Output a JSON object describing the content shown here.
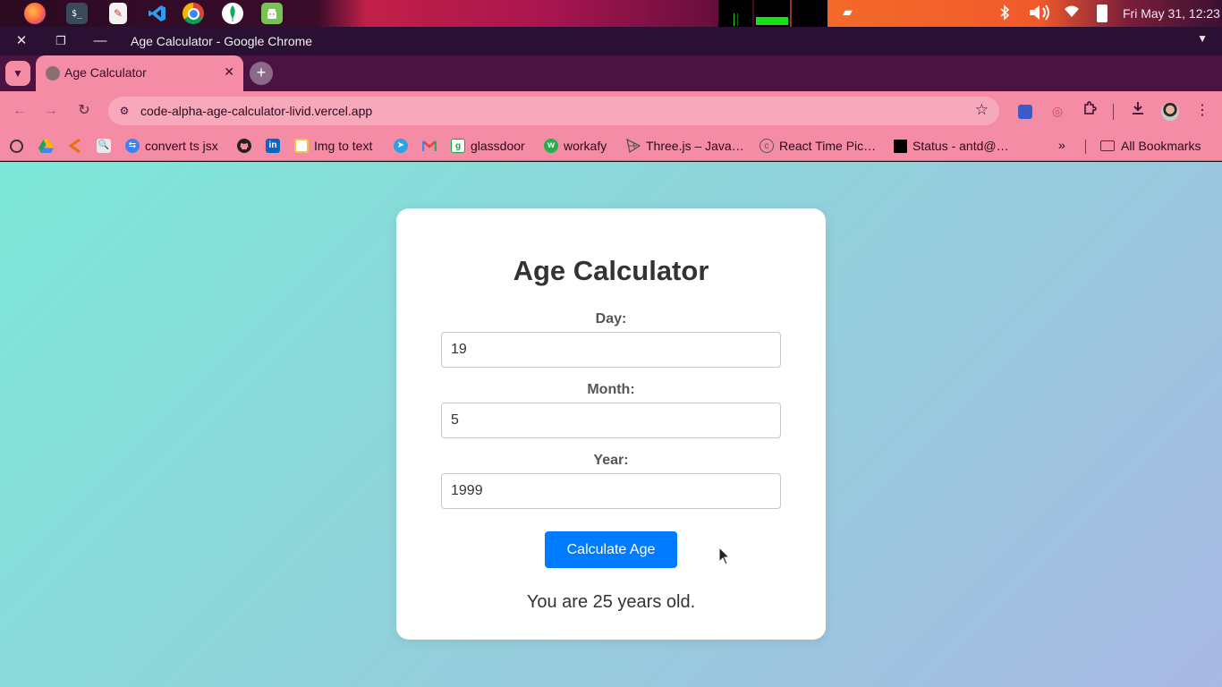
{
  "os": {
    "clock": "Fri May 31, 12:23",
    "launcher": [
      {
        "name": "firefox-icon"
      },
      {
        "name": "terminal-icon",
        "glyph": "$_"
      },
      {
        "name": "document-viewer-icon"
      },
      {
        "name": "vscode-icon"
      },
      {
        "name": "chrome-icon"
      },
      {
        "name": "mongodb-compass-icon"
      },
      {
        "name": "android-studio-icon"
      }
    ]
  },
  "window": {
    "title": "Age Calculator - Google Chrome"
  },
  "tabs": [
    {
      "title": "Age Calculator",
      "active": true
    }
  ],
  "toolbar": {
    "url": "code-alpha-age-calculator-livid.vercel.app"
  },
  "bookmarks": {
    "items": [
      {
        "label": "",
        "icon": "openai-icon",
        "color": "#333333"
      },
      {
        "label": "",
        "icon": "google-drive-icon",
        "color": "#1fa463"
      },
      {
        "label": "",
        "icon": "bookmark-arrow-icon",
        "color": "#e8710a"
      },
      {
        "label": "",
        "icon": "search-site-icon",
        "color": "#cccccc"
      },
      {
        "label": "convert ts jsx",
        "icon": "transform-icon",
        "color": "#3b82f6"
      },
      {
        "label": "",
        "icon": "github-icon",
        "color": "#222222"
      },
      {
        "label": "",
        "icon": "linkedin-icon",
        "color": "#0a66c2"
      },
      {
        "label": "Img to text",
        "icon": "image-to-text-icon",
        "color": "#f6c445"
      },
      {
        "label": "",
        "icon": "telegram-icon",
        "color": "#2aa3e0"
      },
      {
        "label": "",
        "icon": "gmail-icon",
        "color": "#ea4335"
      },
      {
        "label": "glassdoor",
        "icon": "glassdoor-icon",
        "color": "#0caa41"
      },
      {
        "label": "workafy",
        "icon": "workafy-icon",
        "color": "#22b04a"
      },
      {
        "label": "Three.js – Java…",
        "icon": "threejs-icon",
        "color": "#555555"
      },
      {
        "label": "React Time Pic…",
        "icon": "copyright-icon",
        "color": "#555555"
      },
      {
        "label": "Status - antd@…",
        "icon": "status-icon",
        "color": "#000000"
      }
    ],
    "more": "»",
    "all_bookmarks": "All Bookmarks"
  },
  "app": {
    "heading": "Age Calculator",
    "day_label": "Day:",
    "day_value": "19",
    "month_label": "Month:",
    "month_value": "5",
    "year_label": "Year:",
    "year_value": "1999",
    "button_label": "Calculate Age",
    "result": "You are 25 years old.",
    "button_color": "#007bff"
  }
}
